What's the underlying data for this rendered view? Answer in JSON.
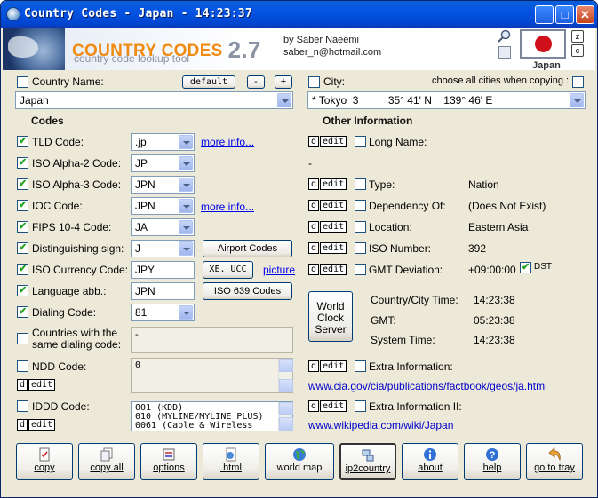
{
  "window": {
    "title": "Country Codes  -  Japan  -  14:23:37"
  },
  "header": {
    "app_name": "COUNTRY CODES",
    "version": "2.7",
    "tagline": "country code lookup tool",
    "author_line1": "by Saber Naeemi",
    "author_line2": "saber_n@hotmail.com",
    "flag_country": "Japan",
    "mini_z": "z",
    "mini_c": "c"
  },
  "country_row": {
    "label": "Country Name:",
    "default_btn": "default",
    "minus_btn": "-",
    "plus_btn": "+",
    "value": "Japan"
  },
  "city_row": {
    "label": "City:",
    "hint": "choose all cities when copying :",
    "value": "* Tokyo  3          35° 41' N    139° 46' E"
  },
  "codes": {
    "title": "Codes",
    "tld": {
      "label": "TLD Code:",
      "value": ".jp",
      "link": "more info..."
    },
    "alpha2": {
      "label": "ISO Alpha-2 Code:",
      "value": "JP"
    },
    "alpha3": {
      "label": "ISO Alpha-3 Code:",
      "value": "JPN"
    },
    "ioc": {
      "label": "IOC Code:",
      "value": "JPN",
      "link": "more info..."
    },
    "fips": {
      "label": "FIPS 10-4 Code:",
      "value": "JA"
    },
    "dist": {
      "label": "Distinguishing sign:",
      "value": "J",
      "button": "Airport Codes"
    },
    "currency": {
      "label": "ISO Currency Code:",
      "value": "JPY",
      "button": "XE. UCC",
      "link": "picture"
    },
    "lang": {
      "label": "Language abb.:",
      "value": "JPN",
      "button": "ISO 639 Codes"
    },
    "dialing": {
      "label": "Dialing Code:",
      "value": "81"
    },
    "same_dialing": {
      "label1": "Countries with the",
      "label2": "same dialing code:",
      "value": "-"
    },
    "ndd": {
      "label": "NDD Code:",
      "value": "0"
    },
    "iddd": {
      "label": "IDDD Code:",
      "lines": [
        "001 (KDD)",
        "010 (MYLINE/MYLINE PLUS)",
        "0061 (Cable & Wireless"
      ]
    }
  },
  "dedit": {
    "d": "d",
    "edit": "edit"
  },
  "other": {
    "title": "Other Information",
    "long_name": {
      "label": "Long Name:",
      "value": "-"
    },
    "type": {
      "label": "Type:",
      "value": "Nation"
    },
    "dependency": {
      "label": "Dependency Of:",
      "value": "(Does Not Exist)"
    },
    "location": {
      "label": "Location:",
      "value": "Eastern Asia"
    },
    "iso_number": {
      "label": "ISO Number:",
      "value": "392"
    },
    "gmt_dev": {
      "label": "GMT Deviation:",
      "value": "+09:00:00",
      "dst": "DST"
    },
    "world_clock": {
      "line1": "World",
      "line2": "Clock",
      "line3": "Server"
    },
    "times": [
      {
        "label": "Country/City Time:",
        "value": "14:23:38"
      },
      {
        "label": "GMT:",
        "value": "05:23:38"
      },
      {
        "label": "System Time:",
        "value": "14:23:38"
      }
    ],
    "extra": {
      "label": "Extra Information:",
      "url": "www.cia.gov/cia/publications/factbook/geos/ja.html"
    },
    "extra2": {
      "label": "Extra Information II:",
      "url": "www.wikipedia.com/wiki/Japan"
    }
  },
  "toolbar": [
    {
      "label": "copy",
      "icon": "copy-doc-icon"
    },
    {
      "label": "copy all",
      "icon": "copy-all-icon"
    },
    {
      "label": "options",
      "icon": "options-icon"
    },
    {
      "label": ".html",
      "icon": "html-icon"
    },
    {
      "label": "world map",
      "icon": "globe-icon"
    },
    {
      "label": "ip2country",
      "icon": "network-icon"
    },
    {
      "label": "about",
      "icon": "info-icon"
    },
    {
      "label": "help",
      "icon": "help-icon"
    },
    {
      "label": "go to tray",
      "icon": "tray-arrow-icon"
    }
  ]
}
